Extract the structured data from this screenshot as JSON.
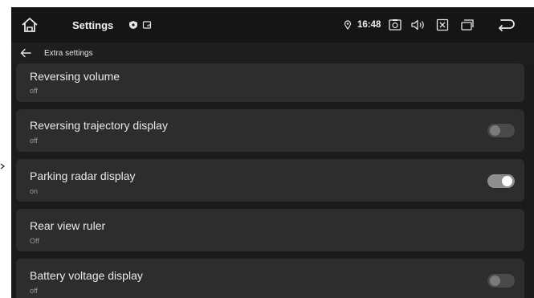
{
  "status_bar": {
    "title": "Settings",
    "time": "16:48"
  },
  "sub_header": {
    "title": "Extra settings"
  },
  "settings": [
    {
      "title": "Reversing volume",
      "value": "off"
    },
    {
      "title": "Reversing trajectory display",
      "value": "off",
      "toggle": false
    },
    {
      "title": "Parking radar display",
      "value": "on",
      "toggle": true
    },
    {
      "title": "Rear view ruler",
      "value": "Off"
    },
    {
      "title": "Battery voltage display",
      "value": "off",
      "toggle": false
    }
  ],
  "colors": {
    "background": "#1b1b1b",
    "row": "#2d2d2d",
    "toggle_on": "#8e8e8e",
    "toggle_off": "#4a4a4a"
  }
}
